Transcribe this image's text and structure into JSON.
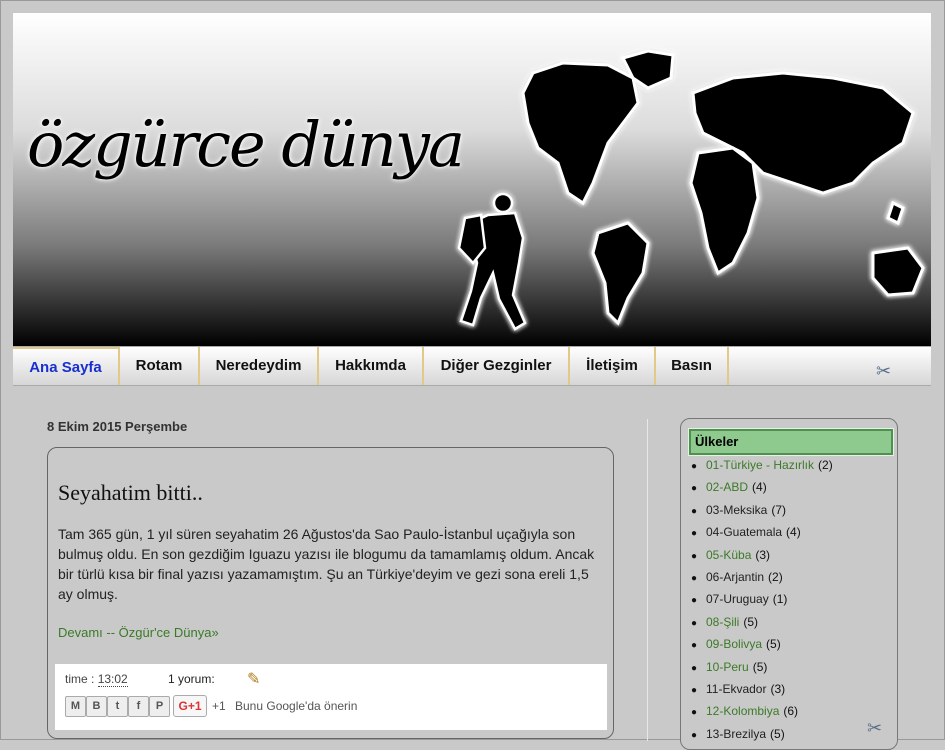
{
  "header": {
    "logo_text": "özgürce dünya"
  },
  "nav": {
    "items": [
      {
        "label": "Ana Sayfa"
      },
      {
        "label": "Rotam"
      },
      {
        "label": "Neredeydim"
      },
      {
        "label": "Hakkımda"
      },
      {
        "label": "Diğer Gezginler"
      },
      {
        "label": "İletişim"
      },
      {
        "label": "Basın"
      }
    ]
  },
  "post": {
    "date": "8 Ekim 2015 Perşembe",
    "title": "Seyahatim bitti..",
    "body": "Tam 365 gün, 1 yıl süren seyahatim 26 Ağustos'da Sao Paulo-İstanbul uçağıyla son bulmuş oldu. En son gezdiğim Iguazu yazısı ile blogumu da tamamlamış oldum. Ancak bir türlü kısa bir final yazısı yazamamıştım. Şu an Türkiye'deyim ve gezi sona ereli 1,5 ay olmuş.",
    "more_link": "Devamı -- Özgür'ce Dünya»",
    "time_label": "time :",
    "time_value": "13:02",
    "comments": "1 yorum:",
    "gplus_label": "G+1",
    "plusone_count": "+1",
    "recommend_text": "Bunu Google'da önerin"
  },
  "sidebar": {
    "title": "Ülkeler",
    "countries": [
      {
        "name": "01-Türkiye - Hazırlık",
        "count": "(2)",
        "green": true
      },
      {
        "name": "02-ABD",
        "count": "(4)",
        "green": true
      },
      {
        "name": "03-Meksika",
        "count": "(7)",
        "green": false
      },
      {
        "name": "04-Guatemala",
        "count": "(4)",
        "green": false
      },
      {
        "name": "05-Küba",
        "count": "(3)",
        "green": true
      },
      {
        "name": "06-Arjantin",
        "count": "(2)",
        "green": false
      },
      {
        "name": "07-Uruguay",
        "count": "(1)",
        "green": false
      },
      {
        "name": "08-Şili",
        "count": "(5)",
        "green": true
      },
      {
        "name": "09-Bolivya",
        "count": "(5)",
        "green": true
      },
      {
        "name": "10-Peru",
        "count": "(5)",
        "green": true
      },
      {
        "name": "11-Ekvador",
        "count": "(3)",
        "green": false
      },
      {
        "name": "12-Kolombiya",
        "count": "(6)",
        "green": true
      },
      {
        "name": "13-Brezilya",
        "count": "(5)",
        "green": false
      }
    ]
  },
  "colors": {
    "link_green": "#3c7a28",
    "nav_active": "#1a2fd0",
    "widget_title_bg": "#8ec98e"
  },
  "icons": {
    "tools": "tools-icon",
    "edit": "pencil-icon"
  }
}
